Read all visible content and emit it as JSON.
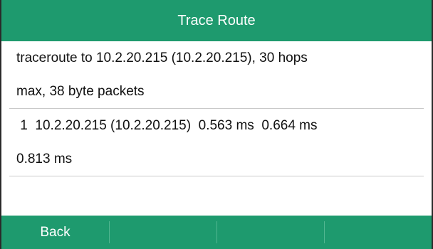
{
  "window": {
    "title": "Trace Route"
  },
  "output": {
    "lines": [
      "traceroute to 10.2.20.215 (10.2.20.215), 30 hops",
      "max, 38 byte packets",
      " 1  10.2.20.215 (10.2.20.215)  0.563 ms  0.664 ms",
      "0.813 ms"
    ]
  },
  "softkeys": [
    {
      "label": "Back"
    },
    {
      "label": ""
    },
    {
      "label": ""
    },
    {
      "label": ""
    }
  ],
  "colors": {
    "accent": "#1e9a6e",
    "text": "#111111",
    "separator": "#c9c9c9"
  }
}
